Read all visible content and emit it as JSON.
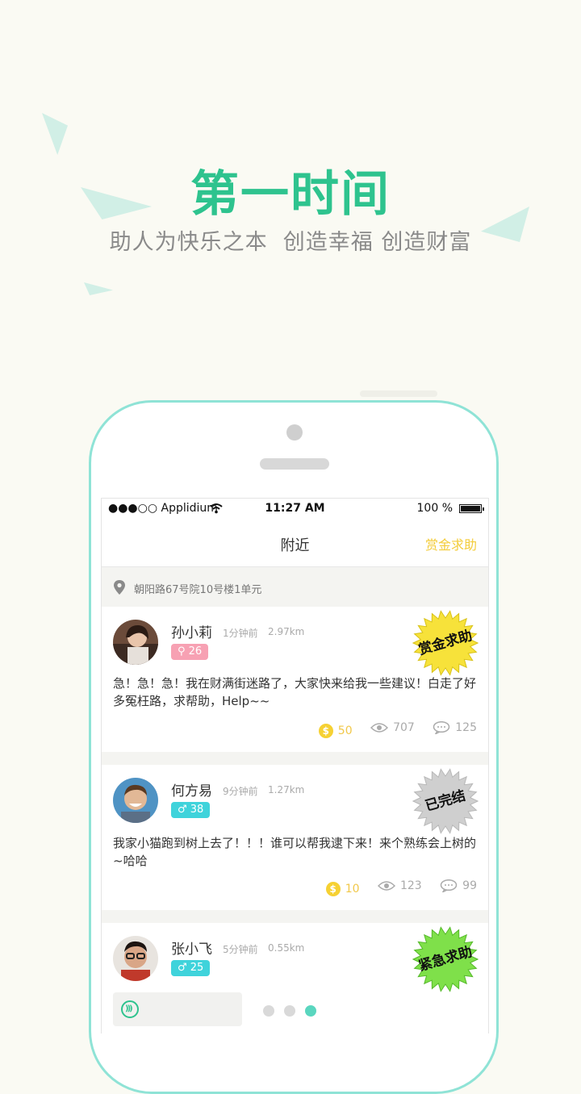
{
  "hero": {
    "title": "第一时间",
    "subtitle": "助人为快乐之本  创造幸福 创造财富"
  },
  "statusbar": {
    "carrier": "●●●○○ Applidium",
    "time": "11:27 AM",
    "battery": "100 %"
  },
  "navbar": {
    "title": "附近",
    "action": "赏金求助"
  },
  "location": {
    "address": "朝阳路67号院10号楼1单元"
  },
  "posts": [
    {
      "name": "孙小莉",
      "time": "1分钟前",
      "distance": "2.97km",
      "badge": "⚲ 26",
      "content": "急！急！急！我在财满街迷路了，大家快来给我一些建议！白走了好多冤枉路，求帮助，Help~~",
      "coins": "50",
      "views": "707",
      "comments": "125",
      "stamp": "赏金求助",
      "stamp_color": "#f7e23a"
    },
    {
      "name": "何方易",
      "time": "9分钟前",
      "distance": "1.27km",
      "badge": "♂ 38",
      "content": "我家小猫跑到树上去了！！！谁可以帮我逮下来！来个熟练会上树的~哈哈",
      "coins": "10",
      "views": "123",
      "comments": "99",
      "stamp": "已完结",
      "stamp_color": "#cfcfcf"
    },
    {
      "name": "张小飞",
      "time": "5分钟前",
      "distance": "0.55km",
      "badge": "♂ 25",
      "stamp": "紧急求助",
      "stamp_color": "#7fe04a"
    }
  ],
  "pager": {
    "count": 3,
    "active": 3
  }
}
